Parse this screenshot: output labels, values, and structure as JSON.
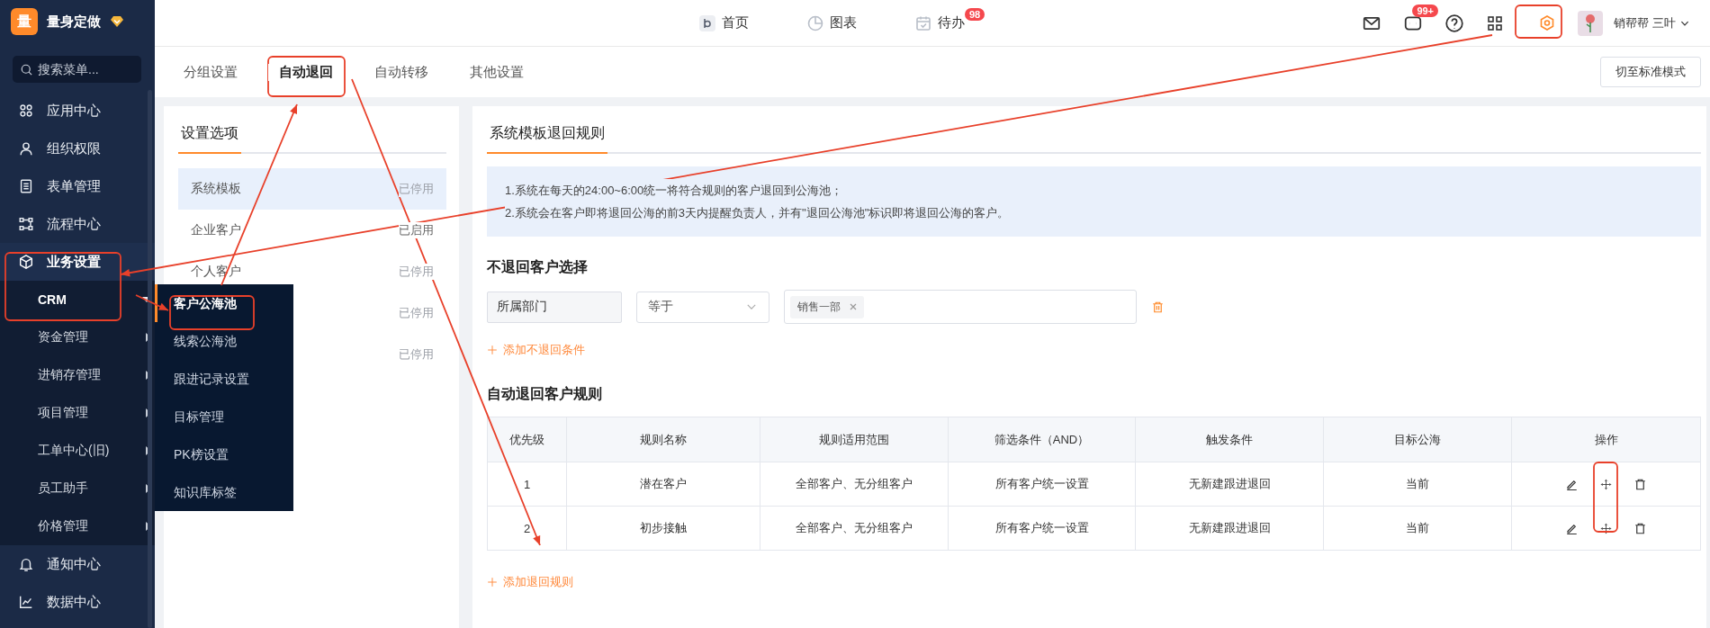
{
  "app": {
    "logo": "量",
    "name": "量身定做"
  },
  "sidebar": {
    "search_placeholder": "搜索菜单...",
    "items": [
      {
        "label": "应用中心"
      },
      {
        "label": "组织权限"
      },
      {
        "label": "表单管理"
      },
      {
        "label": "流程中心"
      },
      {
        "label": "业务设置",
        "expanded": true,
        "children": [
          {
            "label": "CRM",
            "selected": true
          },
          {
            "label": "资金管理",
            "selected": false
          },
          {
            "label": "进销存管理",
            "selected": false
          },
          {
            "label": "项目管理",
            "selected": false
          },
          {
            "label": "工单中心(旧)",
            "selected": false
          },
          {
            "label": "员工助手",
            "selected": false
          },
          {
            "label": "价格管理",
            "selected": false
          }
        ]
      },
      {
        "label": "通知中心"
      },
      {
        "label": "数据中心"
      }
    ]
  },
  "flyout": [
    {
      "label": "客户公海池",
      "selected": true
    },
    {
      "label": "线索公海池",
      "selected": false
    },
    {
      "label": "跟进记录设置",
      "selected": false
    },
    {
      "label": "目标管理",
      "selected": false
    },
    {
      "label": "PK榜设置",
      "selected": false
    },
    {
      "label": "知识库标签",
      "selected": false
    }
  ],
  "top_nav": [
    {
      "label": "首页"
    },
    {
      "label": "图表"
    },
    {
      "label": "待办",
      "badge": "98"
    }
  ],
  "toolbar": {
    "message_badge": "99+",
    "user_name": "销帮帮 三叶"
  },
  "tabs": [
    {
      "label": "分组设置",
      "selected": false
    },
    {
      "label": "自动退回",
      "selected": true
    },
    {
      "label": "自动转移",
      "selected": false
    },
    {
      "label": "其他设置",
      "selected": false
    }
  ],
  "mode_button": "切至标准模式",
  "settings": {
    "title": "设置选项",
    "items": [
      {
        "name": "系统模板",
        "status": "已停用",
        "enabled": false,
        "selected": true
      },
      {
        "name": "企业客户",
        "status": "已启用",
        "enabled": true,
        "selected": false
      },
      {
        "name": "个人客户",
        "status": "已停用",
        "enabled": false,
        "selected": false
      },
      {
        "status": "已停用",
        "enabled": false,
        "selected": false
      },
      {
        "status": "已停用",
        "enabled": false,
        "selected": false
      }
    ]
  },
  "rules": {
    "tab": "系统模板退回规则",
    "notes": [
      "1.系统在每天的24:00~6:00统一将符合规则的客户退回到公海池；",
      "2.系统会在客户即将退回公海的前3天内提醒负责人，并有\"退回公海池\"标识即将退回公海的客户。"
    ],
    "exclude_title": "不退回客户选择",
    "condition": {
      "field": "所属部门",
      "operator": "等于",
      "tags": [
        "销售一部"
      ]
    },
    "add_condition": "添加不退回条件",
    "table_title": "自动退回客户规则",
    "columns": [
      "优先级",
      "规则名称",
      "规则适用范围",
      "筛选条件（AND）",
      "触发条件",
      "目标公海",
      "操作"
    ],
    "rows": [
      [
        "1",
        "潜在客户",
        "全部客户、无分组客户",
        "所有客户统一设置",
        "无新建跟进退回",
        "当前"
      ],
      [
        "2",
        "初步接触",
        "全部客户、无分组客户",
        "所有客户统一设置",
        "无新建跟进退回",
        "当前"
      ]
    ],
    "add_rule": "添加退回规则"
  }
}
